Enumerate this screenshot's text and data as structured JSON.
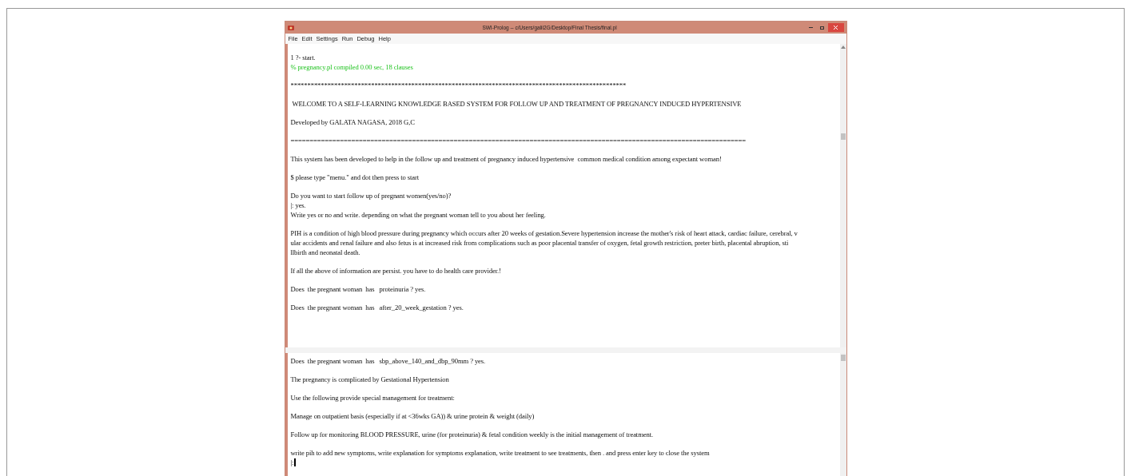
{
  "window": {
    "title": "SWI-Prolog -- c/Users/galii2G/Desktop/Final Thesis/final.pl"
  },
  "menu": [
    "File",
    "Edit",
    "Settings",
    "Run",
    "Debug",
    "Help"
  ],
  "top_pane": {
    "blocks": [
      [
        {
          "text": "1 ?- start.",
          "kind": "plain"
        },
        {
          "text": "% pregnancy.pl compiled 0.00 sec, 18 clauses",
          "kind": "message"
        }
      ],
      [
        {
          "text": "****************************************************************************************************",
          "kind": "plain"
        }
      ],
      [
        {
          "text": " WELCOME TO A SELF-LEARNING KNOWLEDGE BASED SYSTEM FOR FOLLOW UP AND TREATMENT OF PREGNANCY INDUCED HYPERTENSIVE",
          "kind": "plain"
        }
      ],
      [
        {
          "text": "Developed by GALATA NAGASA, 2018 G,C",
          "kind": "plain"
        }
      ],
      [
        {
          "text": "========================================================================================================================",
          "kind": "plain"
        }
      ],
      [
        {
          "text": "This system has been developed to help in the follow up and treatment of pregnancy induced hypertensive  common medical condition among expectant woman!",
          "kind": "plain"
        }
      ],
      [
        {
          "text": "$ please type \"menu.\" and dot then press to start",
          "kind": "plain"
        }
      ],
      [
        {
          "text": "Do you want to start follow up of pregnant women(yes/no)?",
          "kind": "plain"
        },
        {
          "text": "|: yes.",
          "kind": "plain"
        },
        {
          "text": "Write yes or no and write. depending on what the pregnant woman tell to you about her feeling.",
          "kind": "plain"
        }
      ],
      [
        {
          "text": "PIH is a condition of high blood pressure during pregnancy which occurs after 20 weeks of gestation.Severe hypertension increase the mother's risk of heart attack, cardiac failure, cerebral, v",
          "kind": "plain"
        },
        {
          "text": "ular accidents and renal failure and also fetus is at increased risk from complications such as poor placental transfer of oxygen, fetal growth restriction, preter birth, placental abruption, sti",
          "kind": "plain"
        },
        {
          "text": "llbirth and neonatal death.",
          "kind": "plain"
        }
      ],
      [
        {
          "text": "If all the above of information are persist. you have to do health care provider.!",
          "kind": "plain"
        }
      ],
      [
        {
          "text": "Does  the pregnant woman  has   proteinuria ? yes.",
          "kind": "plain"
        }
      ],
      [
        {
          "text": "Does  the pregnant woman  has   after_20_week_gestation ? yes.",
          "kind": "plain"
        }
      ]
    ]
  },
  "bottom_pane": {
    "blocks": [
      [
        {
          "text": "Does  the pregnant woman  has   sbp_above_140_and_dbp_90mm ? yes.",
          "kind": "plain"
        }
      ],
      [
        {
          "text": "The pregnancy is complicated by Gestational Hypertension",
          "kind": "plain"
        }
      ],
      [
        {
          "text": "Use the following provide special management for treatment:",
          "kind": "plain"
        }
      ],
      [
        {
          "text": "Manage on outpatient basis (especially if at <36wks GA)) & urine protein & weight (daily)",
          "kind": "plain"
        }
      ],
      [
        {
          "text": "Follow up for monitoring BLOOD PRESSURE, urine (for proteinuria) & fetal condition weekly is the initial management of treatment.",
          "kind": "plain"
        }
      ],
      [
        {
          "text": "write pih to add new symptoms, write explanation for symptoms explanation, write treatment to see treatments, then . and press enter key to close the system",
          "kind": "plain"
        },
        {
          "text": "|:",
          "kind": "prompt"
        }
      ]
    ]
  }
}
